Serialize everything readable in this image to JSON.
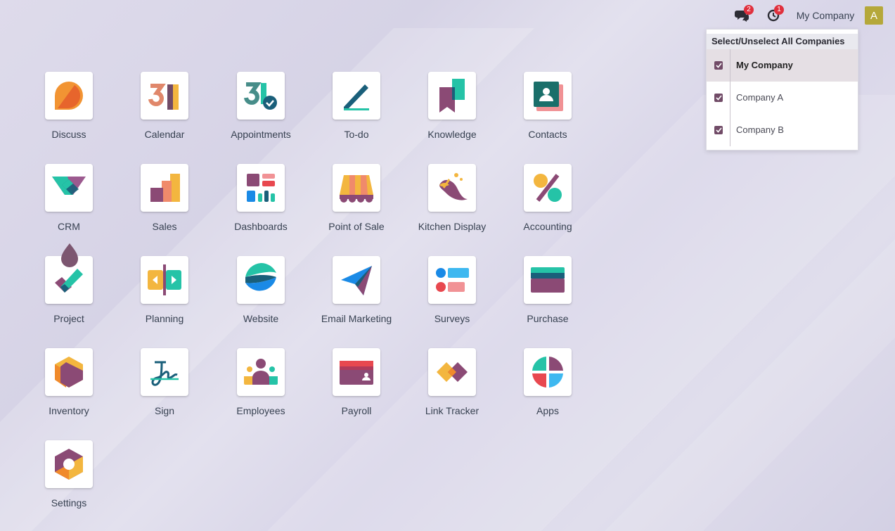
{
  "topbar": {
    "messages_badge": "2",
    "activity_badge": "1",
    "company_name": "My Company",
    "avatar_letter": "A"
  },
  "company_dropdown": {
    "header": "Select/Unselect All Companies",
    "companies": [
      {
        "label": "My Company",
        "checked": true,
        "active": true
      },
      {
        "label": "Company A",
        "checked": true,
        "active": false
      },
      {
        "label": "Company B",
        "checked": true,
        "active": false
      }
    ]
  },
  "apps": [
    {
      "label": "Discuss",
      "icon": "discuss-icon"
    },
    {
      "label": "Calendar",
      "icon": "calendar-icon"
    },
    {
      "label": "Appointments",
      "icon": "appointments-icon"
    },
    {
      "label": "To-do",
      "icon": "todo-icon"
    },
    {
      "label": "Knowledge",
      "icon": "knowledge-icon"
    },
    {
      "label": "Contacts",
      "icon": "contacts-icon"
    },
    {
      "label": "CRM",
      "icon": "crm-icon"
    },
    {
      "label": "Sales",
      "icon": "sales-icon"
    },
    {
      "label": "Dashboards",
      "icon": "dashboards-icon"
    },
    {
      "label": "Point of Sale",
      "icon": "point-of-sale-icon"
    },
    {
      "label": "Kitchen Display",
      "icon": "kitchen-display-icon"
    },
    {
      "label": "Accounting",
      "icon": "accounting-icon"
    },
    {
      "label": "Project",
      "icon": "project-icon"
    },
    {
      "label": "Planning",
      "icon": "planning-icon"
    },
    {
      "label": "Website",
      "icon": "website-icon"
    },
    {
      "label": "Email Marketing",
      "icon": "email-marketing-icon"
    },
    {
      "label": "Surveys",
      "icon": "surveys-icon"
    },
    {
      "label": "Purchase",
      "icon": "purchase-icon"
    },
    {
      "label": "Inventory",
      "icon": "inventory-icon"
    },
    {
      "label": "Sign",
      "icon": "sign-icon"
    },
    {
      "label": "Employees",
      "icon": "employees-icon"
    },
    {
      "label": "Payroll",
      "icon": "payroll-icon"
    },
    {
      "label": "Link Tracker",
      "icon": "link-tracker-icon"
    },
    {
      "label": "Apps",
      "icon": "apps-icon"
    },
    {
      "label": "Settings",
      "icon": "settings-icon"
    }
  ],
  "colors": {
    "brand": "#714b67",
    "badge": "#e0303d",
    "avatar": "#b5a83a"
  }
}
